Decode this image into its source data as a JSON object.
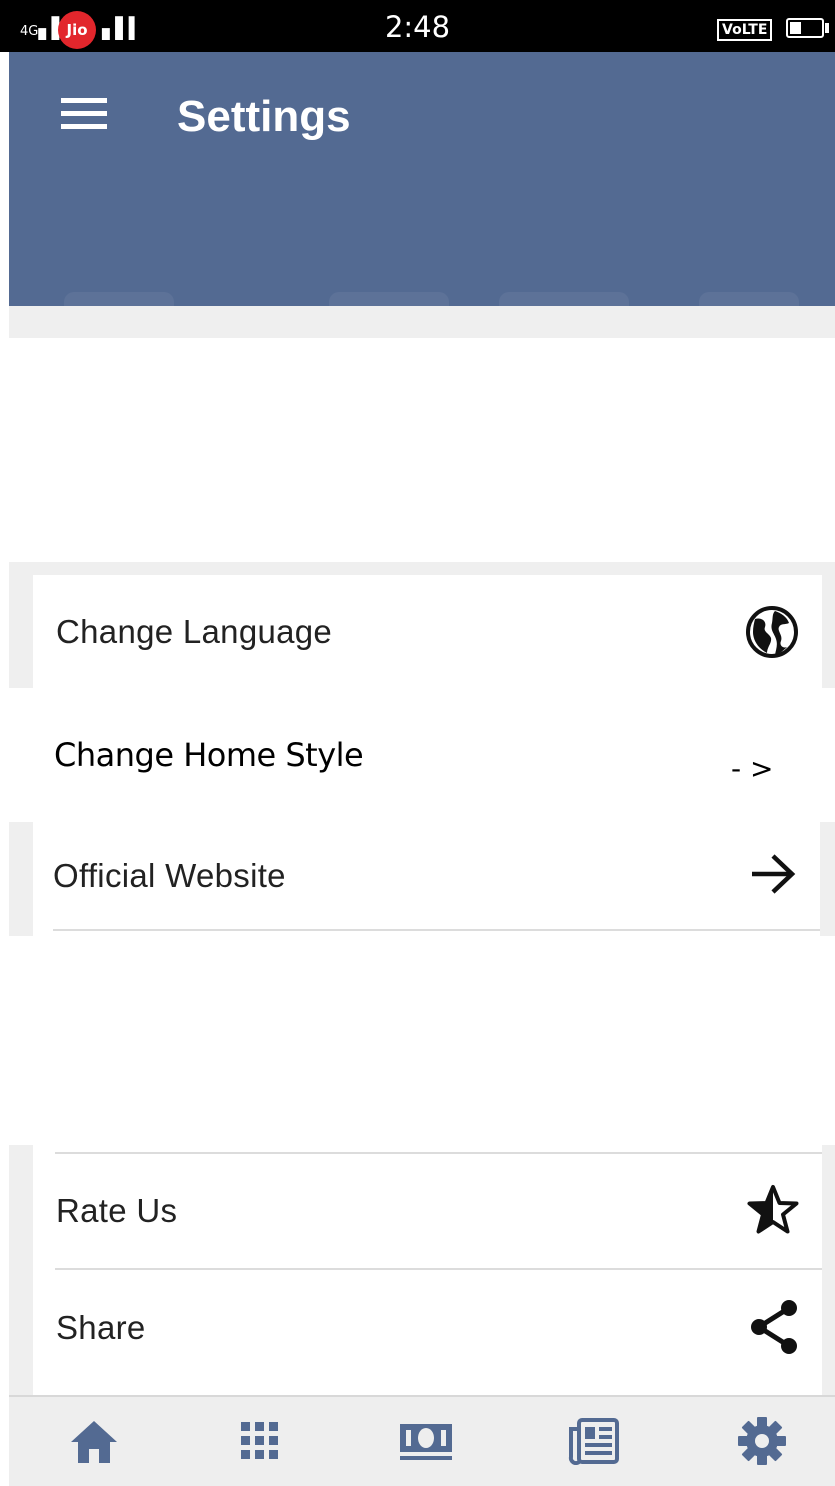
{
  "status_bar": {
    "time": "2:48",
    "network_left": "4G",
    "carrier": "Jio",
    "volte": "VoLTE"
  },
  "app_bar": {
    "title": "Settings",
    "menu_icon": "hamburger-menu-icon",
    "color": "#536a92"
  },
  "settings": {
    "items": [
      {
        "label": "Change Language",
        "icon": "globe-icon"
      },
      {
        "label": "Change Home Style",
        "icon": "dash-arrow-icon",
        "icon_text": "- >"
      },
      {
        "label": "Official Website",
        "icon": "arrow-right-icon"
      },
      {
        "label": "Rate Us",
        "icon": "star-half-icon"
      },
      {
        "label": "Share",
        "icon": "share-icon"
      }
    ]
  },
  "bottom_nav": {
    "items": [
      {
        "name": "home",
        "icon": "home-icon"
      },
      {
        "name": "apps",
        "icon": "grid-icon"
      },
      {
        "name": "money",
        "icon": "money-icon"
      },
      {
        "name": "news",
        "icon": "newspaper-icon"
      },
      {
        "name": "settings",
        "icon": "gear-icon",
        "active": true
      }
    ],
    "icon_color": "#536a92"
  }
}
